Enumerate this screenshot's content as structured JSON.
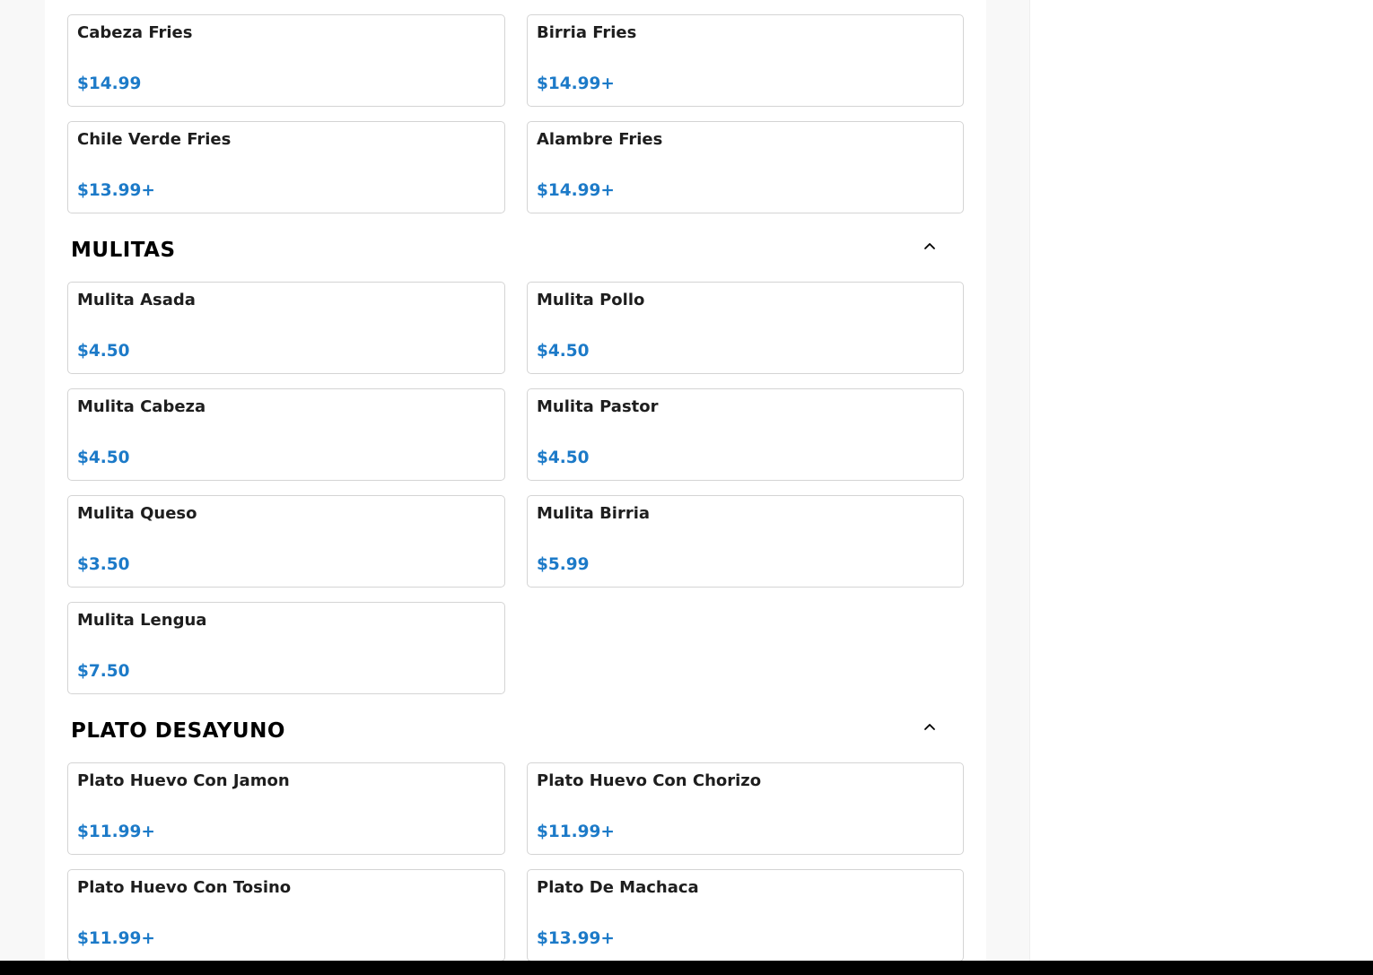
{
  "fries_items": [
    {
      "name": "Cabeza Fries",
      "price": "$14.99"
    },
    {
      "name": "Birria Fries",
      "price": "$14.99+"
    },
    {
      "name": "Chile Verde Fries",
      "price": "$13.99+"
    },
    {
      "name": "Alambre Fries",
      "price": "$14.99+"
    }
  ],
  "mulitas": {
    "title": "MULITAS",
    "collapse_icon": "chevron-up-icon",
    "items": [
      {
        "name": "Mulita Asada",
        "price": "$4.50"
      },
      {
        "name": "Mulita Pollo",
        "price": "$4.50"
      },
      {
        "name": "Mulita Cabeza",
        "price": "$4.50"
      },
      {
        "name": "Mulita Pastor",
        "price": "$4.50"
      },
      {
        "name": "Mulita Queso",
        "price": "$3.50"
      },
      {
        "name": "Mulita Birria",
        "price": "$5.99"
      },
      {
        "name": "Mulita Lengua",
        "price": "$7.50"
      }
    ]
  },
  "plato_desayuno": {
    "title": "PLATO DESAYUNO",
    "collapse_icon": "chevron-up-icon",
    "items": [
      {
        "name": "Plato Huevo Con Jamon",
        "price": "$11.99+"
      },
      {
        "name": "Plato Huevo Con Chorizo",
        "price": "$11.99+"
      },
      {
        "name": "Plato Huevo Con Tosino",
        "price": "$11.99+"
      },
      {
        "name": "Plato De Machaca",
        "price": "$13.99+"
      }
    ]
  },
  "colors": {
    "price": "#1c7ac8",
    "title": "#1e1e1e",
    "border": "#d4d4d4"
  }
}
